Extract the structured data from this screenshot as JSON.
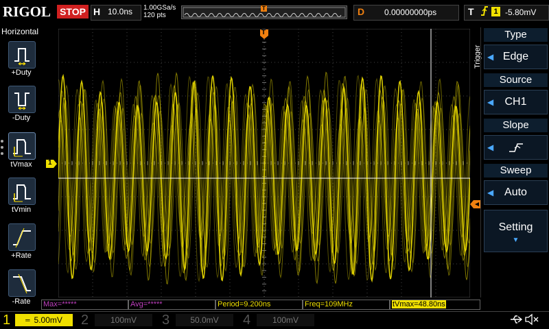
{
  "topbar": {
    "logo": "RIGOL",
    "run_status": "STOP",
    "horizontal_key": "H",
    "timebase": "10.0ns",
    "sample_rate": "1.00GSa/s",
    "points": "120 pts",
    "delay_key": "D",
    "delay": "0.00000000ps",
    "trigger_key": "T",
    "trigger_channel": "1",
    "trigger_level": "-5.80mV"
  },
  "left_panel": {
    "title": "Horizontal",
    "items": [
      {
        "label": "+Duty",
        "icon": "positive-duty-icon"
      },
      {
        "label": "-Duty",
        "icon": "negative-duty-icon"
      },
      {
        "label": "tVmax",
        "icon": "tvmax-icon"
      },
      {
        "label": "tVmin",
        "icon": "tvmin-icon"
      },
      {
        "label": "+Rate",
        "icon": "positive-rate-icon"
      },
      {
        "label": "-Rate",
        "icon": "negative-rate-icon"
      }
    ]
  },
  "right_panel": {
    "section_label": "Trigger",
    "type_label": "Type",
    "type_value": "Edge",
    "source_label": "Source",
    "source_value": "CH1",
    "slope_label": "Slope",
    "slope_icon": "rising-edge-icon",
    "sweep_label": "Sweep",
    "sweep_value": "Auto",
    "setting_label": "Setting"
  },
  "markers": {
    "channel_marker": "1",
    "trigger_position_marker": "T"
  },
  "measurements": [
    {
      "text": "Max=*****",
      "color": "#c040c0"
    },
    {
      "text": "Avg=*****",
      "color": "#c040c0"
    },
    {
      "text": "Period=9.200ns",
      "color": "#f0e000"
    },
    {
      "text": "Freq=109MHz",
      "color": "#f0e000"
    },
    {
      "text": "tVmax=48.80ns",
      "color": "#000000"
    }
  ],
  "channels": [
    {
      "num": "1",
      "scale": "5.00mV",
      "color": "#f0e000",
      "active": true
    },
    {
      "num": "2",
      "scale": "100mV",
      "color": "#00c8e8",
      "active": false
    },
    {
      "num": "3",
      "scale": "50.0mV",
      "color": "#e040e0",
      "active": false
    },
    {
      "num": "4",
      "scale": "100mV",
      "color": "#2080ff",
      "active": false
    }
  ],
  "colors": {
    "ch1": "#f0e000",
    "trigger": "#f08010",
    "stop": "#d02020"
  },
  "waveform": {
    "frequency_label": "Freq=109MHz",
    "cycles_on_screen": 22
  },
  "status_icons": [
    "usb-icon",
    "speaker-mute-icon"
  ]
}
